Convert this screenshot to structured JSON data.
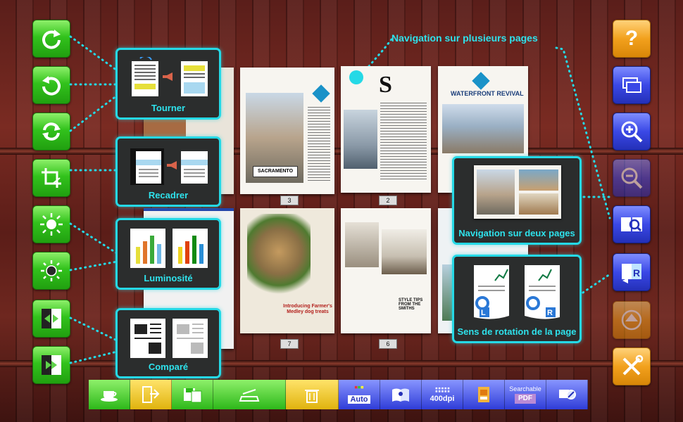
{
  "callouts": {
    "rotate": "Tourner",
    "crop": "Recadrer",
    "brightness": "Luminosité",
    "compare": "Comparé",
    "multi_page_nav": "Navigation sur plusieurs pages",
    "two_page_nav": "Navigation sur deux pages",
    "page_direction": "Sens de rotation de la page"
  },
  "thumbnails": {
    "page_numbers": [
      "3",
      "2",
      "7",
      "6"
    ],
    "sacramento_title": "SACRAMENTO",
    "waterfront_title": "WATERFRONT REVIVAL",
    "dog_treats_title": "Introducing Farmer's Medley dog treats",
    "style_tips_title": "STYLE TIPS FROM THE SMITHS"
  },
  "icons": {
    "help": "?",
    "page_dir_left": "L",
    "page_dir_right": "R",
    "bar_left": "L",
    "bar_right": "R"
  },
  "toolbar": {
    "auto_label": "Auto",
    "dpi_label": "400dpi",
    "searchable_label": "Searchable",
    "pdf_label": "PDF"
  },
  "colors": {
    "accent": "#25d9e6",
    "green": "#32c21c",
    "blue": "#3a48e6",
    "orange": "#f2a11d"
  }
}
